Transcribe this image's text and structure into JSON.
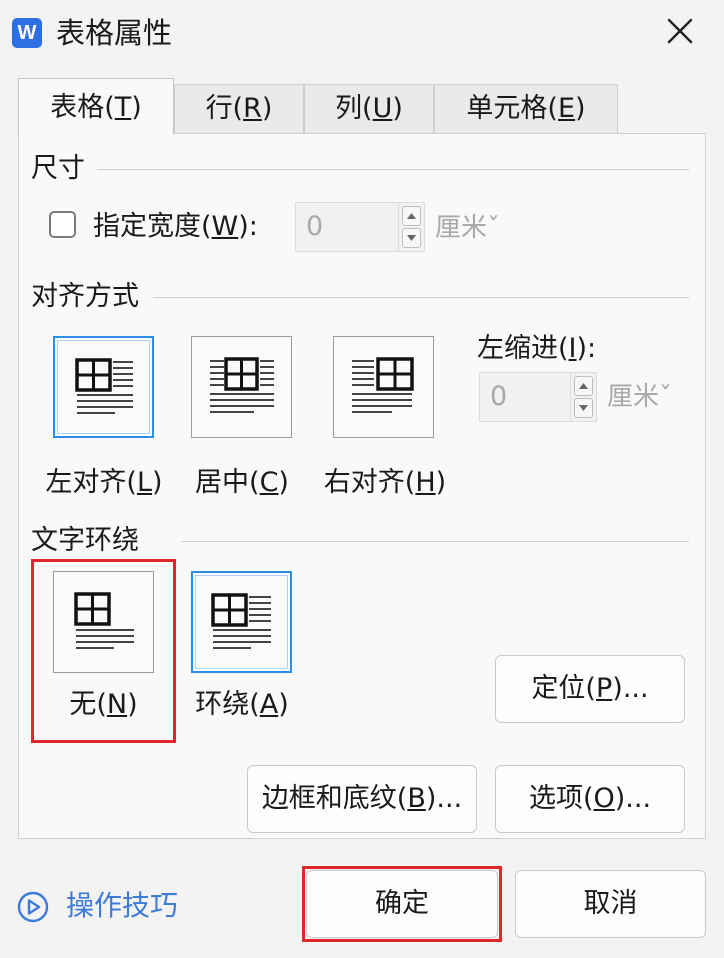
{
  "window": {
    "title": "表格属性",
    "app_icon_letter": "W",
    "close_symbol": "×"
  },
  "tabs": [
    {
      "label": "表格(",
      "key": "T",
      "suffix": ")",
      "active": true
    },
    {
      "label": "行(",
      "key": "R",
      "suffix": ")",
      "active": false
    },
    {
      "label": "列(",
      "key": "U",
      "suffix": ")",
      "active": false
    },
    {
      "label": "单元格(",
      "key": "E",
      "suffix": ")",
      "active": false
    }
  ],
  "size": {
    "group_label": "尺寸",
    "width_checkbox_label_prefix": "指定宽度(",
    "width_checkbox_key": "W",
    "width_checkbox_label_suffix": "):",
    "width_checked": false,
    "width_value": "0",
    "width_unit": "厘米"
  },
  "alignment": {
    "group_label": "对齐方式",
    "options": [
      {
        "prefix": "左对齐(",
        "key": "L",
        "suffix": ")",
        "selected": true
      },
      {
        "prefix": "居中(",
        "key": "C",
        "suffix": ")",
        "selected": false
      },
      {
        "prefix": "右对齐(",
        "key": "H",
        "suffix": ")",
        "selected": false
      }
    ],
    "indent_label_prefix": "左缩进(",
    "indent_key": "I",
    "indent_label_suffix": "):",
    "indent_value": "0",
    "indent_unit": "厘米"
  },
  "wrapping": {
    "group_label": "文字环绕",
    "options": [
      {
        "prefix": "无(",
        "key": "N",
        "suffix": ")",
        "selected": false
      },
      {
        "prefix": "环绕(",
        "key": "A",
        "suffix": ")",
        "selected": true
      }
    ]
  },
  "buttons": {
    "position": {
      "prefix": "定位(",
      "key": "P",
      "suffix": ")..."
    },
    "borders": {
      "prefix": "边框和底纹(",
      "key": "B",
      "suffix": ")..."
    },
    "options": {
      "prefix": "选项(",
      "key": "O",
      "suffix": ")..."
    },
    "ok": "确定",
    "cancel": "取消"
  },
  "tips": {
    "label": "操作技巧",
    "icon": "play-circle-icon"
  },
  "colors": {
    "accent_blue": "#2d8ee8",
    "highlight_red": "#e0262c",
    "tips_blue": "#3d7bd8",
    "app_icon_blue": "#2f6fe4"
  }
}
